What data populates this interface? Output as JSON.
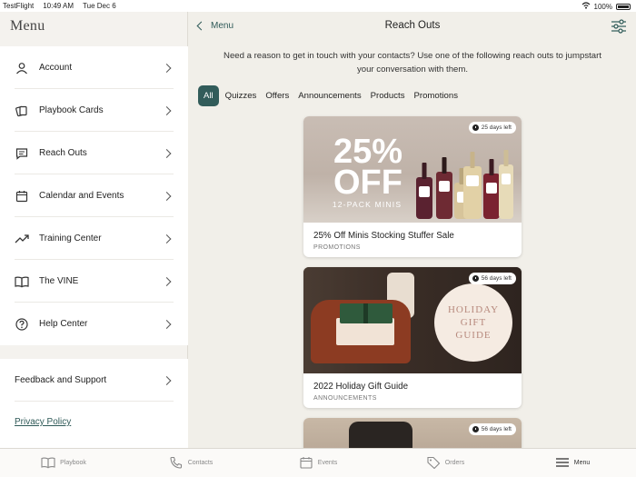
{
  "status_bar": {
    "carrier": "TestFlight",
    "time": "10:49 AM",
    "date": "Tue Dec 6",
    "battery": "100%"
  },
  "sidebar": {
    "title": "Menu",
    "items": [
      {
        "label": "Account",
        "icon": "user-icon"
      },
      {
        "label": "Playbook Cards",
        "icon": "cards-icon"
      },
      {
        "label": "Reach Outs",
        "icon": "chat-icon"
      },
      {
        "label": "Calendar and Events",
        "icon": "calendar-icon"
      },
      {
        "label": "Training Center",
        "icon": "trending-icon"
      },
      {
        "label": "The VINE",
        "icon": "book-icon"
      },
      {
        "label": "Help Center",
        "icon": "help-icon"
      }
    ],
    "secondary": {
      "feedback": "Feedback and Support",
      "privacy": "Privacy Policy"
    }
  },
  "header": {
    "back_label": "Menu",
    "title": "Reach Outs"
  },
  "intro": "Need a reason to get in touch with your contacts? Use one of the following reach outs to jumpstart your conversation with them.",
  "tabs": [
    "All",
    "Quizzes",
    "Offers",
    "Announcements",
    "Products",
    "Promotions"
  ],
  "cards": [
    {
      "title": "25% Off Minis Stocking Stuffer Sale",
      "category": "PROMOTIONS",
      "days_left": "25 days left",
      "image_text": {
        "big_line1": "25%",
        "big_line2": "OFF",
        "sub": "12-PACK MINIS"
      }
    },
    {
      "title": "2022 Holiday Gift Guide",
      "category": "ANNOUNCEMENTS",
      "days_left": "56 days left",
      "image_text": {
        "line1": "HOLIDAY",
        "line2": "GIFT",
        "line3": "GUIDE"
      }
    },
    {
      "days_left": "56 days left"
    }
  ],
  "tabbar": [
    {
      "label": "Playbook",
      "icon": "book-icon"
    },
    {
      "label": "Contacts",
      "icon": "phone-icon"
    },
    {
      "label": "Events",
      "icon": "calendar-icon"
    },
    {
      "label": "Orders",
      "icon": "tag-icon"
    },
    {
      "label": "Menu",
      "icon": "hamburger-icon"
    }
  ],
  "colors": {
    "accent": "#325c5a",
    "background": "#f1efe9"
  }
}
